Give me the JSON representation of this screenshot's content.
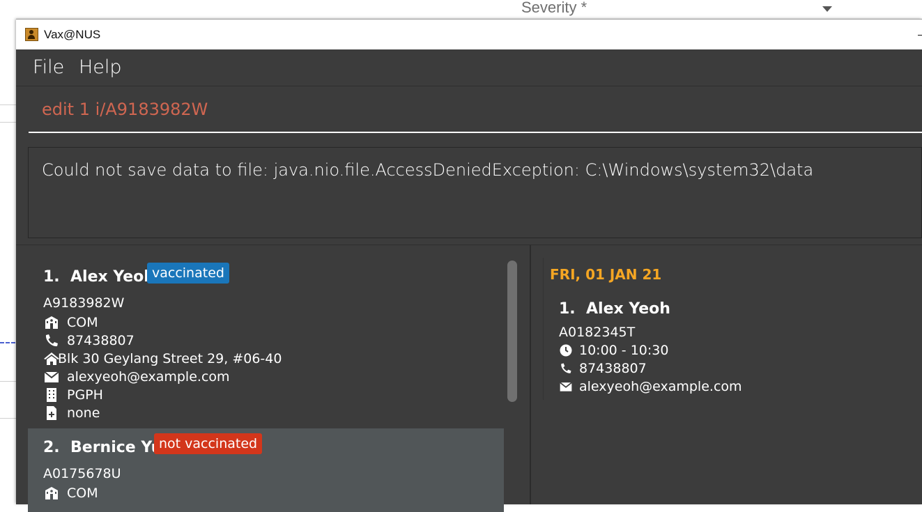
{
  "background": {
    "severity_label": "Severity *"
  },
  "window": {
    "title": "Vax@NUS"
  },
  "menu": {
    "file": "File",
    "help": "Help"
  },
  "command": {
    "value": "edit 1 i/A9183982W"
  },
  "result": {
    "message": "Could not save data to file: java.nio.file.AccessDeniedException: C:\\Windows\\system32\\data"
  },
  "students": [
    {
      "index": "1.",
      "name": "Alex Yeoh",
      "status": "vaccinated",
      "id": "A9183982W",
      "faculty": "COM",
      "phone": "87438807",
      "address": "Blk 30 Geylang Street 29, #06-40",
      "email": "alexyeoh@example.com",
      "residence": "PGPH",
      "medical": "none"
    },
    {
      "index": "2.",
      "name": "Bernice Yu",
      "status": "not vaccinated",
      "id": "A0175678U",
      "faculty": "COM"
    }
  ],
  "appointments": [
    {
      "date": "FRI, 01 JAN 21",
      "index": "1.",
      "name": "Alex Yeoh",
      "id": "A0182345T",
      "time": "10:00 - 10:30",
      "phone": "87438807",
      "email": "alexyeoh@example.com"
    }
  ],
  "colors": {
    "vaccinated": "#1a76ba",
    "not_vaccinated": "#d3361b",
    "date_accent": "#f5a623",
    "command_text": "#d06651"
  }
}
